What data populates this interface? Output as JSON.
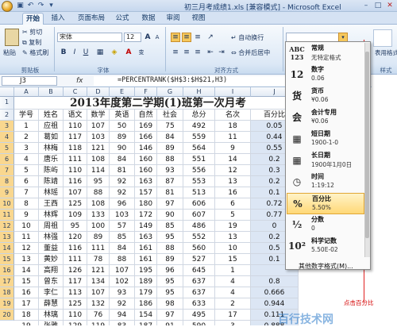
{
  "window": {
    "title": "初三月考成绩1.xls  [兼容模式] - Microsoft Excel"
  },
  "tabs": [
    "开始",
    "插入",
    "页面布局",
    "公式",
    "数据",
    "审阅",
    "视图"
  ],
  "ribbon": {
    "clipboard": {
      "cut": "剪切",
      "copy": "复制",
      "format_painter": "格式刷",
      "paste": "粘贴",
      "label": "剪贴板"
    },
    "font": {
      "name": "宋体",
      "size": "12",
      "label": "字体",
      "bold": "B",
      "italic": "I",
      "underline": "U",
      "font_color_letter": "A",
      "grow": "A",
      "shrink": "A"
    },
    "alignment": {
      "wrap_text": "自动换行",
      "merge_center": "合并后居中",
      "label": "对齐方式"
    },
    "right": {
      "label_style": "样式",
      "table_format": "表用格式"
    }
  },
  "formula_bar": {
    "name_box": "J3",
    "fx": "fx",
    "formula": "=PERCENTRANK($H$3:$H$21,H3)"
  },
  "sheet": {
    "columns": [
      "A",
      "B",
      "C",
      "D",
      "E",
      "F",
      "G",
      "H",
      "I",
      "J"
    ],
    "title": "2013年度第二学期(1)班第一次月考",
    "row_numbers": [
      "1",
      "2",
      "3",
      "4",
      "5",
      "6",
      "7",
      "8",
      "9",
      "10",
      "11",
      "12",
      "13",
      "14",
      "15",
      "16",
      "17",
      "18",
      "19",
      "20"
    ],
    "headers": [
      "学号",
      "姓名",
      "语文",
      "数学",
      "英语",
      "自然",
      "社会",
      "总分",
      "名次",
      "百分比"
    ],
    "rows": [
      [
        "1",
        "应祖",
        "110",
        "107",
        "50",
        "169",
        "75",
        "492",
        "18",
        "0.05"
      ],
      [
        "2",
        "葛如",
        "117",
        "103",
        "89",
        "166",
        "84",
        "559",
        "11",
        "0.44"
      ],
      [
        "3",
        "林梅",
        "118",
        "121",
        "90",
        "146",
        "89",
        "564",
        "9",
        "0.55"
      ],
      [
        "4",
        "唐乐",
        "111",
        "108",
        "84",
        "160",
        "88",
        "551",
        "14",
        "0.2"
      ],
      [
        "5",
        "陈屿",
        "110",
        "114",
        "81",
        "160",
        "93",
        "556",
        "12",
        "0.3"
      ],
      [
        "6",
        "陈靖",
        "116",
        "95",
        "92",
        "163",
        "87",
        "553",
        "13",
        "0.2"
      ],
      [
        "7",
        "林瑶",
        "107",
        "88",
        "92",
        "157",
        "81",
        "513",
        "16",
        "0.1"
      ],
      [
        "8",
        "王西",
        "125",
        "108",
        "96",
        "180",
        "97",
        "606",
        "6",
        "0.72"
      ],
      [
        "9",
        "林辉",
        "109",
        "133",
        "103",
        "172",
        "90",
        "607",
        "5",
        "0.77"
      ],
      [
        "10",
        "周祖",
        "95",
        "100",
        "57",
        "149",
        "85",
        "486",
        "19",
        "0"
      ],
      [
        "11",
        "林强",
        "120",
        "89",
        "85",
        "163",
        "95",
        "552",
        "13",
        "0.2"
      ],
      [
        "12",
        "董益",
        "116",
        "111",
        "84",
        "161",
        "88",
        "560",
        "10",
        "0.5"
      ],
      [
        "13",
        "黄妙",
        "111",
        "78",
        "88",
        "161",
        "89",
        "527",
        "15",
        "0.1"
      ],
      [
        "14",
        "高翔",
        "126",
        "121",
        "107",
        "195",
        "96",
        "645",
        "1",
        ""
      ],
      [
        "15",
        "曾东",
        "117",
        "134",
        "102",
        "189",
        "95",
        "637",
        "4",
        "0.8"
      ],
      [
        "16",
        "李仁",
        "113",
        "107",
        "93",
        "179",
        "95",
        "637",
        "4",
        "0.666"
      ],
      [
        "17",
        "薛慧",
        "125",
        "132",
        "92",
        "186",
        "98",
        "633",
        "2",
        "0.944"
      ],
      [
        "18",
        "林璃",
        "110",
        "76",
        "94",
        "154",
        "97",
        "495",
        "17",
        "0.111"
      ],
      [
        "19",
        "张雅",
        "129",
        "119",
        "83",
        "187",
        "91",
        "590",
        "3",
        "0.888"
      ]
    ]
  },
  "format_menu": {
    "items": [
      {
        "icon": "ABC 123",
        "name": "常规",
        "example": "无特定格式"
      },
      {
        "icon": "12",
        "name": "数字",
        "example": "0.06"
      },
      {
        "icon": "货",
        "name": "货币",
        "example": "¥0.06"
      },
      {
        "icon": "会",
        "name": "会计专用",
        "example": "¥0.06"
      },
      {
        "icon": "▦",
        "name": "短日期",
        "example": "1900-1-0"
      },
      {
        "icon": "▦",
        "name": "长日期",
        "example": "1900年1月0日"
      },
      {
        "icon": "◷",
        "name": "时间",
        "example": "1:19:12"
      },
      {
        "icon": "%",
        "name": "百分比",
        "example": "5.50%"
      },
      {
        "icon": "½",
        "name": "分数",
        "example": "0"
      },
      {
        "icon": "10²",
        "name": "科学记数",
        "example": "5.50E-02"
      }
    ],
    "more": "其他数字格式(M)..."
  },
  "annotation": "点击百分比",
  "watermark": "百行技术网",
  "colors": {
    "accent_red": "#e02020",
    "highlight": "#ffd877"
  }
}
